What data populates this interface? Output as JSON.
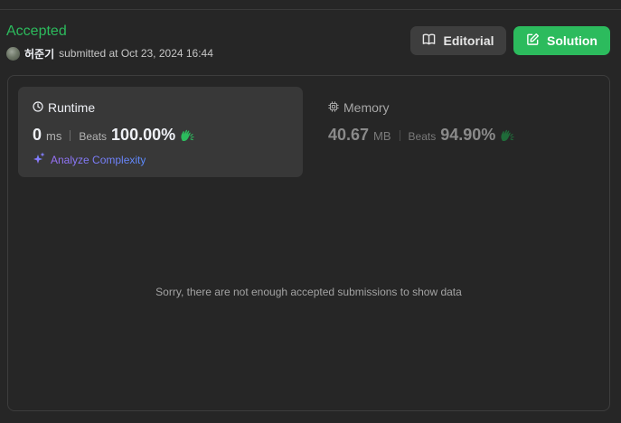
{
  "submission": {
    "status": "Accepted",
    "username": "허준기",
    "submitted_text": "submitted at Oct 23, 2024 16:44"
  },
  "buttons": {
    "editorial": "Editorial",
    "solution": "Solution"
  },
  "runtime": {
    "title": "Runtime",
    "value": "0",
    "unit": "ms",
    "beats_label": "Beats",
    "beats_pct": "100.00%"
  },
  "memory": {
    "title": "Memory",
    "value": "40.67",
    "unit": "MB",
    "beats_label": "Beats",
    "beats_pct": "94.90%"
  },
  "analyze_label": "Analyze Complexity",
  "empty_message": "Sorry, there are not enough accepted submissions to show data",
  "colors": {
    "accepted": "#2cbb5d",
    "background": "#262626",
    "card": "#383838",
    "analyze_start": "#a86cf7",
    "analyze_end": "#5b8cff"
  },
  "icons": [
    "clock-icon",
    "chip-icon",
    "book-icon",
    "edit-icon",
    "sparkle-icon",
    "clap-hands-icon"
  ]
}
